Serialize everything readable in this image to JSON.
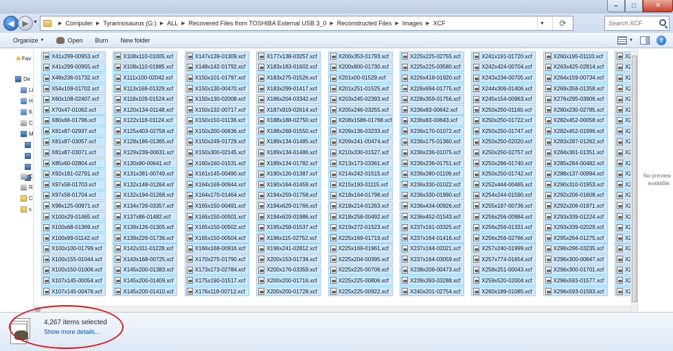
{
  "breadcrumb": [
    "Computer",
    "Tyrannosaurus (G:)",
    "ALL",
    "Recovered Files from TOSHIBA External USB 3_0",
    "Reconstructed Files",
    "Images",
    "XCF"
  ],
  "search": {
    "placeholder": "Search XCF"
  },
  "toolbar": {
    "organize": "Organize",
    "open": "Open",
    "burn": "Burn",
    "new_folder": "New folder"
  },
  "nav": {
    "favorites": "Fav",
    "items": [
      "De",
      "Li",
      "H",
      "K",
      "C",
      "M",
      "",
      "",
      "",
      "",
      "C",
      "R",
      "C",
      "x",
      "x"
    ]
  },
  "preview": {
    "text": "No preview available."
  },
  "details": {
    "count": "4,267 items selected",
    "more": "Show more details..."
  },
  "colors": {
    "selection_bg": "#cce8ff",
    "selection_border": "#99cfff",
    "highlight_circle": "#e01818",
    "link": "#0b4fb0"
  },
  "files": [
    [
      "X41x299-00953.xcf",
      "X41x299-00955.xcf",
      "X48x236-01732.xcf",
      "X54x109-01702.xcf",
      "X60x108-02407.xcf",
      "X70x47-01062.xcf",
      "X80x66-01796.xcf",
      "X81x87-02937.xcf",
      "X81x87-03057.xcf",
      "X81x87-03071.xcf",
      "X85x60-02804.xcf",
      "X92x181-02791.xcf",
      "X97x58-01703.xcf",
      "X97x58-01704.xcf",
      "X98x125-00971.xcf",
      "X100x29-01465.xcf",
      "X100x68-01369.xcf",
      "X100x99-01142.xcf",
      "X100x100-01799.xcf",
      "X100x155-01044.xcf",
      "X100x150-01006.xcf",
      "X107x145-00054.xcf",
      "X107x145-00476.xcf"
    ],
    [
      "X108x110-01005.xcf",
      "X108x110-01985.xcf",
      "X111x100-02042.xcf",
      "X113x168-01329.xcf",
      "X118x109-01524.xcf",
      "X120x134-01148.xcf",
      "X122x118-01124.xcf",
      "X125x403-02758.xcf",
      "X128x186-01365.xcf",
      "X129x239-00631.xcf",
      "X130x90-00641.xcf",
      "X131x381-00749.xcf",
      "X132x148-01264.xcf",
      "X132x194-01268.xcf",
      "X134x726-03357.xcf",
      "X137x86-01482.xcf",
      "X139x126-01305.xcf",
      "X139x226-01736.xcf",
      "X142x311-01228.xcf",
      "X143x168-00725.xcf",
      "X145x200-01383.xcf",
      "X145x200-01409.xcf",
      "X145x200-01410.xcf"
    ],
    [
      "X147x139-01309.xcf",
      "X148x142-01792.xcf",
      "X150x101-01797.xcf",
      "X150x130-00470.xcf",
      "X150x130-02008.xcf",
      "X150x132-00717.xcf",
      "X150x150-01138.xcf",
      "X150x200-00636.xcf",
      "X150x249-01729.xcf",
      "X150x300-02145.xcf",
      "X160x160-01531.xcf",
      "X161x145-00490.xcf",
      "X164x169-00944.xcf",
      "X164x170-01464.xcf",
      "X165x150-00491.xcf",
      "X165x150-00501.xcf",
      "X165x150-00502.xcf",
      "X165x150-00504.xcf",
      "X166x168-00916.xcf",
      "X170x275-01790.xcf",
      "X173x173-02784.xcf",
      "X175x190-01517.xcf",
      "X176x118-00712.xcf"
    ],
    [
      "X177x138-03257.xcf",
      "X183x183-01602.xcf",
      "X183x275-01526.xcf",
      "X183x299-01417.xcf",
      "X186x204-03342.xcf",
      "X187x919-02614.xcf",
      "X188x188-02750.xcf",
      "X188x268-01550.xcf",
      "X189x134-01485.xcf",
      "X189x134-01486.xcf",
      "X189x134-01782.xcf",
      "X190x126-01387.xcf",
      "X190x164-01459.xcf",
      "X194x259-01758.xcf",
      "X194x629-01766.xcf",
      "X194x629-01986.xcf",
      "X195x258-01537.xcf",
      "X196x115-02752.xcf",
      "X196x241-02812.xcf",
      "X200x153-01734.xcf",
      "X200x176-03359.xcf",
      "X200x200-01716.xcf",
      "X200x200-01728.xcf"
    ],
    [
      "X200x353-01793.xcf",
      "X200x800-01730.xcf",
      "X201x00-01529.xcf",
      "X201x251-01525.xcf",
      "X203x245-02393.xcf",
      "X205x246-03255.xcf",
      "X208x1586-01768.xcf",
      "X209x136-03233.xcf",
      "X209x241-00474.xcf",
      "X210x330-01527.xcf",
      "X213x173-03361.xcf",
      "X214x242-01515.xcf",
      "X215x193-01115.xcf",
      "X218x164-01798.xcf",
      "X218x214-01263.xcf",
      "X218x258-00492.xcf",
      "X219x272-01523.xcf",
      "X225x169-01719.xcf",
      "X225x169-01961.xcf",
      "X225x204-00395.xcf",
      "X225x225-00706.xcf",
      "X225x225-00806.xcf",
      "X225x225-00922.xcf"
    ],
    [
      "X225x225-02755.xcf",
      "X225x225-03580.xcf",
      "X226x418-01920.xcf",
      "X226x694-01775.xcf",
      "X228x359-01756.xcf",
      "X236x83-00642.xcf",
      "X236x83-00643.xcf",
      "X236x170-01072.xcf",
      "X236x175-01360.xcf",
      "X236x236-01075.xcf",
      "X236x236-01751.xcf",
      "X236x280-01109.xcf",
      "X236x330-01022.xcf",
      "X236x330-01990.xcf",
      "X236x434-00926.xcf",
      "X236x452-01543.xcf",
      "X237x161-03325.xcf",
      "X237x164-01416.xcf",
      "X237x164-02021.xcf",
      "X237x164-03059.xcf",
      "X238x206-00473.xcf",
      "X239x393-03288.xcf",
      "X240x201-02754.xcf"
    ],
    [
      "X241x191-01720.xcf",
      "X242x424-00704.xcf",
      "X243x234-00705.xcf",
      "X244x306-01406.xcf",
      "X245x154-00963.xcf",
      "X250x250-01160.xcf",
      "X250x250-01722.xcf",
      "X250x250-01747.xcf",
      "X250x250-02020.xcf",
      "X250x250-02757.xcf",
      "X250x286-01740.xcf",
      "X250x250-01742.xcf",
      "X252x444-00465.xcf",
      "X254x244-01590.xcf",
      "X255x197-00736.xcf",
      "X256x256-00984.xcf",
      "X256x256-01331.xcf",
      "X256x256-02766.xcf",
      "X257x240-01999.xcf",
      "X257x774-01654.xcf",
      "X258x251-00043.xcf",
      "X259x520-02004.xcf",
      "X260x189-01085.xcf"
    ],
    [
      "X260x195-01110.xcf",
      "X263x425-02814.xcf",
      "X264x159-00734.xcf",
      "X269x358-01358.xcf",
      "X276x295-03906.xcf",
      "X280x230-02785.xcf",
      "X282x452-00058.xcf",
      "X282x452-01996.xcf",
      "X283x287-01262.xcf",
      "X284x361-01351.xcf",
      "X285x284-00482.xcf",
      "X288x137-00994.xcf",
      "X290x310-01953.xcf",
      "X292x206-01608.xcf",
      "X292x206-01971.xcf",
      "X293x339-01224.xcf",
      "X293x339-02029.xcf",
      "X295x264-01275.xcf",
      "X296x296-03235.xcf",
      "X296x300-00647.xcf",
      "X296x300-01701.xcf",
      "X296x593-01577.xcf",
      "X296x593-01583.xcf"
    ],
    [
      "X2",
      "X2",
      "X2",
      "X2",
      "X2",
      "X2",
      "X2",
      "X2",
      "X2",
      "X2",
      "X2",
      "X2",
      "X2",
      "X2",
      "X2",
      "X2",
      "X2",
      "X2",
      "X2",
      "X2",
      "X2",
      "X2",
      "X2"
    ]
  ]
}
